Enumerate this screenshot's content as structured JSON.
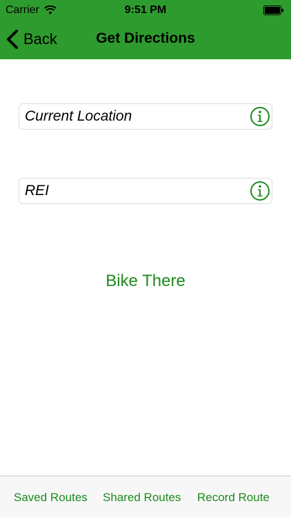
{
  "status_bar": {
    "carrier": "Carrier",
    "time": "9:51 PM"
  },
  "nav": {
    "back_label": "Back",
    "title": "Get Directions"
  },
  "form": {
    "origin_value": "Current Location",
    "destination_value": "REI"
  },
  "action": {
    "bike_label": "Bike There"
  },
  "tabs": [
    {
      "label": "Saved Routes"
    },
    {
      "label": "Shared Routes"
    },
    {
      "label": "Record Route"
    }
  ],
  "colors": {
    "header_green": "#2e9b2e",
    "accent_green": "#1e8a1e"
  }
}
